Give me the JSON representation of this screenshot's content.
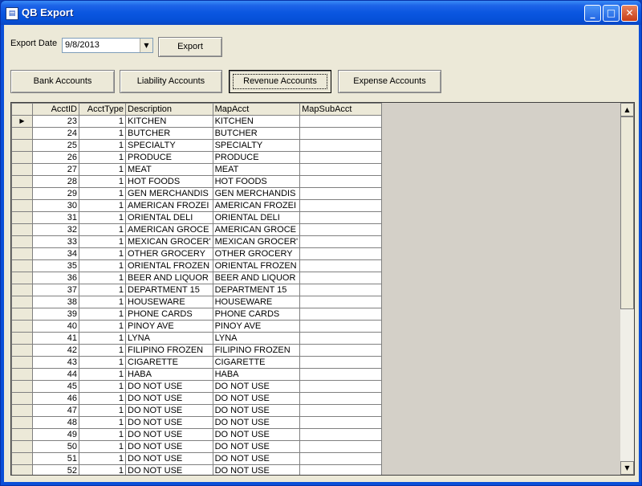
{
  "window": {
    "title": "QB Export"
  },
  "export_date": {
    "label": "Export Date",
    "value": "9/8/2013"
  },
  "buttons": {
    "export": "Export",
    "bank": "Bank Accounts",
    "liability": "Liability Accounts",
    "revenue": "Revenue Accounts",
    "expense": "Expense Accounts"
  },
  "grid": {
    "columns": [
      "AcctID",
      "AcctType",
      "Description",
      "MapAcct",
      "MapSubAcct"
    ],
    "rows": [
      [
        "23",
        "1",
        "KITCHEN",
        "KITCHEN",
        ""
      ],
      [
        "24",
        "1",
        "BUTCHER",
        "BUTCHER",
        ""
      ],
      [
        "25",
        "1",
        "SPECIALTY",
        "SPECIALTY",
        ""
      ],
      [
        "26",
        "1",
        "PRODUCE",
        "PRODUCE",
        ""
      ],
      [
        "27",
        "1",
        "MEAT",
        "MEAT",
        ""
      ],
      [
        "28",
        "1",
        "HOT FOODS",
        "HOT FOODS",
        ""
      ],
      [
        "29",
        "1",
        "GEN MERCHANDIS",
        "GEN MERCHANDIS",
        ""
      ],
      [
        "30",
        "1",
        "AMERICAN FROZEI",
        "AMERICAN FROZEI",
        ""
      ],
      [
        "31",
        "1",
        "ORIENTAL DELI",
        "ORIENTAL DELI",
        ""
      ],
      [
        "32",
        "1",
        "AMERICAN GROCE",
        "AMERICAN GROCE",
        ""
      ],
      [
        "33",
        "1",
        "MEXICAN GROCER'",
        "MEXICAN GROCER'",
        ""
      ],
      [
        "34",
        "1",
        "OTHER GROCERY",
        "OTHER GROCERY",
        ""
      ],
      [
        "35",
        "1",
        "ORIENTAL FROZEN",
        "ORIENTAL FROZEN",
        ""
      ],
      [
        "36",
        "1",
        "BEER AND LIQUOR",
        "BEER AND LIQUOR",
        ""
      ],
      [
        "37",
        "1",
        "DEPARTMENT 15",
        "DEPARTMENT 15",
        ""
      ],
      [
        "38",
        "1",
        "HOUSEWARE",
        "HOUSEWARE",
        ""
      ],
      [
        "39",
        "1",
        "PHONE CARDS",
        "PHONE CARDS",
        ""
      ],
      [
        "40",
        "1",
        "PINOY AVE",
        "PINOY AVE",
        ""
      ],
      [
        "41",
        "1",
        "LYNA",
        "LYNA",
        ""
      ],
      [
        "42",
        "1",
        "FILIPINO FROZEN",
        "FILIPINO FROZEN",
        ""
      ],
      [
        "43",
        "1",
        "CIGARETTE",
        "CIGARETTE",
        ""
      ],
      [
        "44",
        "1",
        "HABA",
        "HABA",
        ""
      ],
      [
        "45",
        "1",
        "DO NOT USE",
        "DO NOT USE",
        ""
      ],
      [
        "46",
        "1",
        "DO NOT USE",
        "DO NOT USE",
        ""
      ],
      [
        "47",
        "1",
        "DO NOT USE",
        "DO NOT USE",
        ""
      ],
      [
        "48",
        "1",
        "DO NOT USE",
        "DO NOT USE",
        ""
      ],
      [
        "49",
        "1",
        "DO NOT USE",
        "DO NOT USE",
        ""
      ],
      [
        "50",
        "1",
        "DO NOT USE",
        "DO NOT USE",
        ""
      ],
      [
        "51",
        "1",
        "DO NOT USE",
        "DO NOT USE",
        ""
      ],
      [
        "52",
        "1",
        "DO NOT USE",
        "DO NOT USE",
        ""
      ]
    ]
  }
}
